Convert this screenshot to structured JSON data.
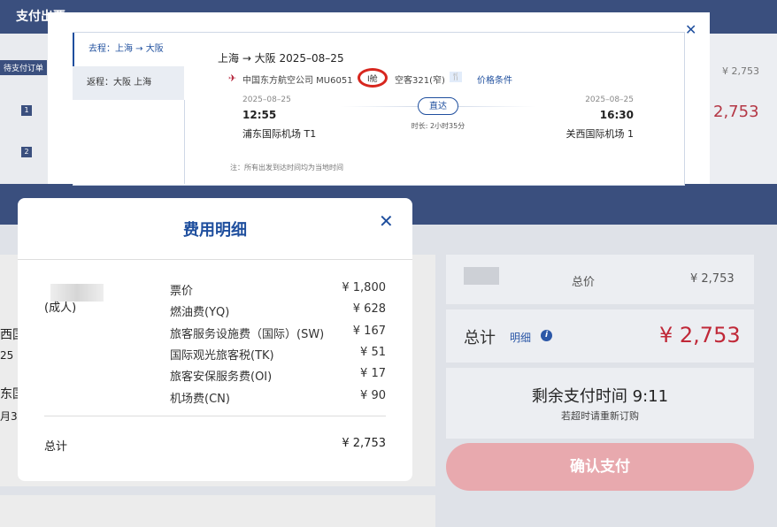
{
  "page": {
    "title": "支付出票",
    "pending_badge": "待支付订单",
    "list_numbers": [
      "1",
      "2"
    ],
    "bg_price_small": "¥ 2,753",
    "bg_price_red": "2,753",
    "left_partials": [
      "西国",
      "25",
      "东国",
      "月3"
    ]
  },
  "flight_popup": {
    "close_icon": "close-icon",
    "tabs": {
      "outbound": "去程：上海 → 大阪",
      "return": "返程：大阪 上海"
    },
    "route_title": "上海 → 大阪 2025–08–25",
    "airline": "中国东方航空公司 MU6051",
    "cabin": "I舱",
    "aircraft": "空客321(窄)",
    "meal_icon": "meal-icon",
    "price_conditions": "价格条件",
    "departure": {
      "date": "2025–08–25",
      "time": "12:55",
      "airport": "浦东国际机场 T1"
    },
    "arrival": {
      "date": "2025–08–25",
      "time": "16:30",
      "airport": "关西国际机场 1"
    },
    "direct": "直达",
    "duration": "时长: 2小时35分",
    "note": "注：所有出发到达时间均为当地时间"
  },
  "summary": {
    "price_label": "总价",
    "price_value": "¥ 2,753",
    "total_label": "总计",
    "detail_link": "明细",
    "total_value": "¥ 2,753",
    "timer": "剩余支付时间 9:11",
    "timer_sub": "若超时请重新订购",
    "confirm": "确认支付"
  },
  "fee_modal": {
    "title": "费用明细",
    "passenger_type": "(成人)",
    "rows": [
      {
        "label": "票价",
        "value": "¥ 1,800"
      },
      {
        "label": "燃油费(YQ)",
        "value": "¥ 628"
      },
      {
        "label": "旅客服务设施费（国际）(SW)",
        "value": "¥ 167"
      },
      {
        "label": "国际观光旅客税(TK)",
        "value": "¥ 51"
      },
      {
        "label": "旅客安保服务费(OI)",
        "value": "¥ 17"
      },
      {
        "label": "机场费(CN)",
        "value": "¥ 90"
      }
    ],
    "total_label": "总计",
    "total_value": "¥ 2,753"
  },
  "colors": {
    "brand_blue": "#1f4f9e",
    "price_red": "#c02838",
    "cabin_highlight": "#d7261e",
    "header_navy": "#3a4f7e"
  }
}
